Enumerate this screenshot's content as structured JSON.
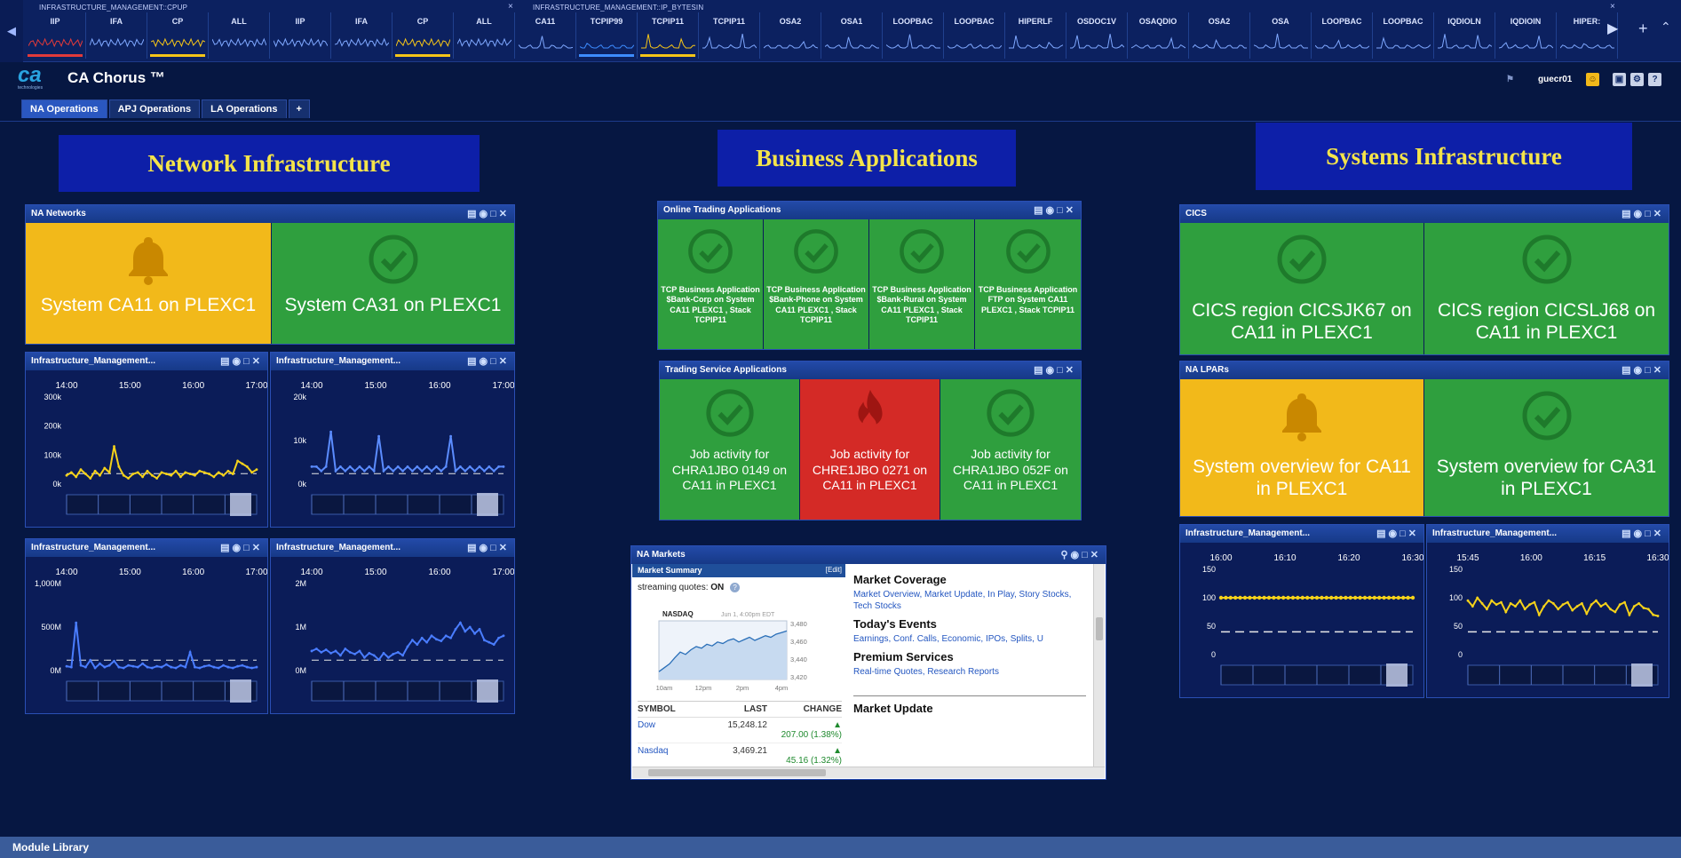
{
  "strip": {
    "group1_title": "INFRASTRUCTURE_MANAGEMENT::CPUP",
    "group2_title": "INFRASTRUCTURE_MANAGEMENT::IP_BYTESIN",
    "items": [
      {
        "label": "IIP",
        "color": "#e23a3a"
      },
      {
        "label": "IFA",
        "color": ""
      },
      {
        "label": "CP",
        "color": "#f5c518"
      },
      {
        "label": "ALL",
        "color": ""
      },
      {
        "label": "IIP",
        "color": ""
      },
      {
        "label": "IFA",
        "color": ""
      },
      {
        "label": "CP",
        "color": "#f5c518"
      },
      {
        "label": "ALL",
        "color": ""
      },
      {
        "label": "CA11",
        "color": ""
      },
      {
        "label": "TCPIP99",
        "color": "#3d8cff"
      },
      {
        "label": "TCPIP11",
        "color": "#f5c518"
      },
      {
        "label": "TCPIP11",
        "color": ""
      },
      {
        "label": "OSA2",
        "color": ""
      },
      {
        "label": "OSA1",
        "color": ""
      },
      {
        "label": "LOOPBAC",
        "color": ""
      },
      {
        "label": "LOOPBAC",
        "color": ""
      },
      {
        "label": "HIPERLF",
        "color": ""
      },
      {
        "label": "OSDOC1V",
        "color": ""
      },
      {
        "label": "OSAQDIO",
        "color": ""
      },
      {
        "label": "OSA2",
        "color": ""
      },
      {
        "label": "OSA",
        "color": ""
      },
      {
        "label": "LOOPBAC",
        "color": ""
      },
      {
        "label": "LOOPBAC",
        "color": ""
      },
      {
        "label": "IQDIOLN",
        "color": ""
      },
      {
        "label": "IQDIOIN",
        "color": ""
      },
      {
        "label": "HIPER:",
        "color": ""
      }
    ]
  },
  "header": {
    "app_title": "CA Chorus ™",
    "logo_sub": "technologies",
    "username": "guecr01",
    "tabs": [
      "NA Operations",
      "APJ Operations",
      "LA Operations",
      "+"
    ]
  },
  "sections": {
    "network": "Network Infrastructure",
    "business": "Business Applications",
    "systems": "Systems Infrastructure"
  },
  "panels": {
    "na_networks": {
      "title": "NA Networks",
      "tiles": [
        {
          "text": "System CA11 on PLEXC1",
          "status": "warn",
          "icon": "bell-icon"
        },
        {
          "text": "System CA31 on PLEXC1",
          "status": "ok",
          "icon": "check-icon"
        }
      ]
    },
    "online_trading": {
      "title": "Online Trading Applications",
      "tiles": [
        {
          "text": "TCP Business Application $Bank-Corp on System CA11 PLEXC1 , Stack TCPIP11",
          "status": "ok"
        },
        {
          "text": "TCP Business Application $Bank-Phone on System CA11 PLEXC1 , Stack TCPIP11",
          "status": "ok"
        },
        {
          "text": "TCP Business Application $Bank-Rural on System CA11 PLEXC1 , Stack TCPIP11",
          "status": "ok"
        },
        {
          "text": "TCP Business Application FTP on System CA11 PLEXC1 , Stack TCPIP11",
          "status": "ok"
        }
      ]
    },
    "trading_service": {
      "title": "Trading Service Applications",
      "tiles": [
        {
          "text": "Job activity for CHRA1JBO 0149 on CA11 in PLEXC1",
          "status": "ok"
        },
        {
          "text": "Job activity for CHRE1JBO 0271 on CA11 in PLEXC1",
          "status": "crit"
        },
        {
          "text": "Job activity for CHRA1JBO 052F on CA11 in PLEXC1",
          "status": "ok"
        }
      ]
    },
    "cics": {
      "title": "CICS",
      "tiles": [
        {
          "text": "CICS region CICSJK67 on CA11 in PLEXC1",
          "status": "ok"
        },
        {
          "text": "CICS region CICSLJ68 on CA11 in PLEXC1",
          "status": "ok"
        }
      ]
    },
    "na_lpars": {
      "title": "NA LPARs",
      "tiles": [
        {
          "text": "System overview for CA11 in PLEXC1",
          "status": "warn"
        },
        {
          "text": "System overview for CA31 in PLEXC1",
          "status": "ok"
        }
      ]
    },
    "na_markets": {
      "title": "NA Markets"
    }
  },
  "charts": [
    {
      "title": "Infrastructure_Management...",
      "times": [
        "14:00",
        "15:00",
        "16:00",
        "17:00"
      ],
      "yticks": [
        "300k",
        "200k",
        "100k",
        "0k"
      ],
      "ylim": [
        0,
        300
      ],
      "color": "#f5d21a",
      "values": [
        30,
        40,
        25,
        50,
        35,
        20,
        45,
        30,
        55,
        40,
        130,
        60,
        30,
        20,
        35,
        40,
        25,
        45,
        30,
        20,
        40,
        35,
        30,
        45,
        25,
        40,
        35,
        30,
        45,
        40,
        35,
        25,
        40,
        30,
        45,
        35,
        80,
        70,
        60,
        40,
        50
      ],
      "baseline": null
    },
    {
      "title": "Infrastructure_Management...",
      "times": [
        "14:00",
        "15:00",
        "16:00",
        "17:00"
      ],
      "yticks": [
        "20k",
        "10k",
        "0k"
      ],
      "ylim": [
        0,
        20
      ],
      "color": "#5b8cff",
      "values": [
        4,
        4,
        3,
        4,
        12,
        3,
        4,
        3,
        4,
        3,
        4,
        3,
        4,
        3,
        11,
        3,
        4,
        3,
        4,
        3,
        4,
        3,
        4,
        3,
        4,
        3,
        4,
        3,
        4,
        11,
        3,
        4,
        3,
        4,
        3,
        4,
        3,
        4,
        3,
        4,
        4
      ],
      "baseline": null
    },
    {
      "title": "Infrastructure_Management...",
      "times": [
        "14:00",
        "15:00",
        "16:00",
        "17:00"
      ],
      "yticks": [
        "1,000M",
        "500M",
        "0M"
      ],
      "ylim": [
        0,
        1000
      ],
      "color": "#4a7dff",
      "values": [
        50,
        40,
        550,
        60,
        40,
        120,
        30,
        80,
        40,
        60,
        110,
        40,
        30,
        60,
        50,
        40,
        80,
        40,
        30,
        50,
        40,
        70,
        40,
        30,
        60,
        40,
        210,
        40,
        30,
        50,
        60,
        40,
        30,
        60,
        40,
        30,
        50,
        60,
        40,
        30,
        40
      ],
      "baseline": null
    },
    {
      "title": "Infrastructure_Management...",
      "times": [
        "14:00",
        "15:00",
        "16:00",
        "17:00"
      ],
      "yticks": [
        "2M",
        "1M",
        "0M"
      ],
      "ylim": [
        0,
        2
      ],
      "color": "#4a7dff",
      "values": [
        0.45,
        0.5,
        0.42,
        0.48,
        0.4,
        0.45,
        0.35,
        0.5,
        0.42,
        0.38,
        0.45,
        0.3,
        0.4,
        0.35,
        0.25,
        0.4,
        0.3,
        0.38,
        0.42,
        0.35,
        0.55,
        0.7,
        0.6,
        0.75,
        0.65,
        0.8,
        0.72,
        0.68,
        0.8,
        0.75,
        0.95,
        1.1,
        0.9,
        1.0,
        0.85,
        0.95,
        0.7,
        0.65,
        0.6,
        0.75,
        0.8
      ],
      "baseline": null
    },
    {
      "title": "Infrastructure_Management...",
      "times": [
        "16:00",
        "16:10",
        "16:20",
        "16:30"
      ],
      "yticks": [
        "150",
        "100",
        "50",
        "0"
      ],
      "ylim": [
        0,
        150
      ],
      "color": "#f5d21a",
      "values": [
        100,
        100,
        100,
        100,
        100,
        100,
        100,
        100,
        100,
        100,
        100,
        100,
        100,
        100,
        100,
        100,
        100,
        100,
        100,
        100,
        100,
        100,
        100,
        100,
        100,
        100,
        100,
        100,
        100,
        100,
        100,
        100,
        100,
        100,
        100,
        100,
        100,
        100,
        100,
        100,
        100
      ],
      "baseline": 40,
      "dots": true
    },
    {
      "title": "Infrastructure_Management...",
      "times": [
        "15:45",
        "16:00",
        "16:15",
        "16:30"
      ],
      "yticks": [
        "150",
        "100",
        "50",
        "0"
      ],
      "ylim": [
        0,
        150
      ],
      "color": "#f5d21a",
      "values": [
        95,
        85,
        100,
        90,
        80,
        95,
        88,
        92,
        75,
        90,
        85,
        95,
        80,
        88,
        92,
        70,
        85,
        95,
        90,
        80,
        88,
        92,
        78,
        85,
        90,
        72,
        88,
        95,
        85,
        90,
        80,
        75,
        88,
        92,
        70,
        85,
        90,
        82,
        80,
        70,
        68
      ],
      "baseline": 40,
      "dots": false
    }
  ],
  "market": {
    "summary_title": "Market Summary",
    "edit_label": "[Edit]",
    "streaming_label": "streaming quotes:",
    "streaming_value": "ON",
    "chart_index": "NASDAQ",
    "chart_date": "Jun 1, 4:00pm EDT",
    "chart_yticks": [
      "3,480",
      "3,460",
      "3,440",
      "3,420"
    ],
    "chart_xticks": [
      "10am",
      "12pm",
      "2pm",
      "4pm"
    ],
    "chart_values": [
      3420,
      3425,
      3430,
      3438,
      3445,
      3442,
      3448,
      3452,
      3450,
      3455,
      3453,
      3458,
      3456,
      3460,
      3462,
      3458,
      3461,
      3464,
      3460,
      3463,
      3466,
      3464,
      3468,
      3470,
      3472
    ],
    "table_headers": [
      "SYMBOL",
      "LAST",
      "CHANGE"
    ],
    "rows": [
      {
        "symbol": "Dow",
        "last": "15,248.12",
        "change": "207.00 (1.38%)"
      },
      {
        "symbol": "Nasdaq",
        "last": "3,469.21",
        "change": "45.16 (1.32%)"
      }
    ],
    "sections": [
      {
        "title": "Market Coverage",
        "links": "Market Overview, Market Update, In Play, Story Stocks, Tech Stocks"
      },
      {
        "title": "Today's Events",
        "links": "Earnings, Conf. Calls, Economic, IPOs, Splits, U"
      },
      {
        "title": "Premium Services",
        "links": "Real-time Quotes, Research Reports"
      },
      {
        "title": "Market Update",
        "links": ""
      }
    ]
  },
  "footer": {
    "module_library": "Module Library"
  }
}
